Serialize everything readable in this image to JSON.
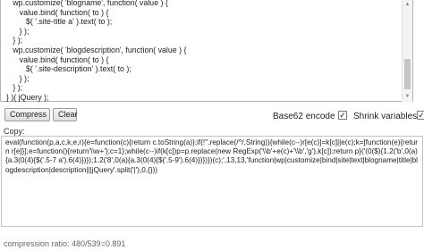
{
  "input": {
    "code": "   wp.customize( 'blogname', function( value ) {\n      value.bind( function( to ) {\n         $( '.site-title a' ).text( to );\n      } );\n   } );\n   wp.customize( 'blogdescription', function( value ) {\n      value.bind( function( to ) {\n         $( '.site-description' ).text( to );\n      } );\n   } );\n} )( jQuery );"
  },
  "buttons": {
    "compress_label": "Compress",
    "clear_label": "Clear"
  },
  "options": {
    "base62_label": "Base62 encode",
    "base62_checked": true,
    "shrink_label": "Shrink variables",
    "shrink_checked": true
  },
  "output": {
    "label": "Copy:",
    "code": "eval(function(p,a,c,k,e,r){e=function(c){return c.toString(a)};if(!''.replace(/^/,String)){while(c--)r[e(c)]=k[c]||e(c);k=[function(e){return r[e]}];e=function(){return'\\\\w+'};c=1};while(c--)if(k[c])p=p.replace(new RegExp('\\\\b'+e(c)+'\\\\b','g'),k[c]);return p}('(0($){1.2('b',0(a){a.3(0(4){$('.5-7 a').6(4)})});1.2('8',0(a){a.3(0(4){$('.5-9').6(4)})})})(c);',13,13,'function|wp|customize|bind|site|text|blogname|title|blogdescription|description|||jQuery'.split('|'),0,{}))"
  },
  "stats": {
    "ratio_text": "compression ratio: 480/539=0.891"
  }
}
